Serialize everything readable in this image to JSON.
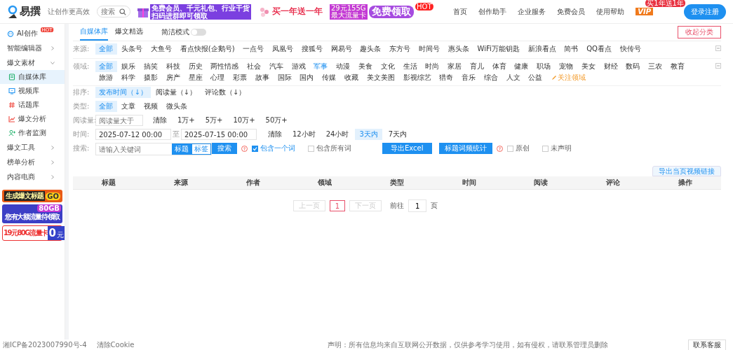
{
  "header": {
    "logo": "易撰",
    "slogan": "让创作更高效",
    "search": {
      "placeholder": "搜索"
    },
    "banners": [
      {
        "kind": "gift",
        "lines": [
          "免费会员、千元礼包、行业干货",
          "扫码进群即可领取"
        ]
      },
      {
        "kind": "flower",
        "lines": [
          "买一年送一年"
        ]
      },
      {
        "kind": "card",
        "lines": [
          "29元155G",
          "最大流量卡",
          "免费领取",
          "HOT"
        ]
      }
    ],
    "nav": [
      "首页",
      "创作助手",
      "企业服务",
      "免费会员",
      "使用帮助"
    ],
    "vip": {
      "label": "VIP",
      "tag": "买1年送1年"
    },
    "login": "登录注册"
  },
  "sidebar": {
    "items": [
      {
        "kind": "link",
        "label": "AI创作",
        "badge": "HOT",
        "selected": false
      },
      {
        "kind": "group",
        "label": "智能编辑器",
        "expanded": false
      },
      {
        "kind": "group",
        "label": "爆文素材",
        "expanded": true,
        "children": [
          {
            "label": "自媒体库",
            "selected": true
          },
          {
            "label": "视频库",
            "selected": false
          },
          {
            "label": "话题库",
            "selected": false
          },
          {
            "label": "爆文分析",
            "selected": false
          },
          {
            "label": "作者监测",
            "selected": false
          }
        ]
      },
      {
        "kind": "group",
        "label": "爆文工具",
        "expanded": false
      },
      {
        "kind": "group",
        "label": "榜单分析",
        "expanded": false
      },
      {
        "kind": "group",
        "label": "内容电商",
        "expanded": false
      }
    ],
    "ads": [
      {
        "kind": "title",
        "lines": [
          "生成爆文标题",
          "GO"
        ]
      },
      {
        "kind": "traffic",
        "lines": [
          "80GB",
          "您有大额流量待领取"
        ]
      },
      {
        "kind": "simcard",
        "lines": [
          "19元80G流量卡",
          "0",
          "元"
        ]
      }
    ]
  },
  "tabs": [
    {
      "label": "自媒体库",
      "selected": true
    },
    {
      "label": "爆文精选",
      "selected": false
    }
  ],
  "simple_mode": {
    "label": "简洁模式",
    "on": false
  },
  "collapse_button": "收起分类",
  "filters": [
    {
      "kind": "options",
      "label": "来源:",
      "expanded": true,
      "options": [
        {
          "label": "全部",
          "selected": true,
          "highlighted": false
        },
        {
          "label": "头条号",
          "selected": false,
          "highlighted": false
        },
        {
          "label": "大鱼号",
          "selected": false,
          "highlighted": false
        },
        {
          "label": "看点快报(企鹅号)",
          "selected": false,
          "highlighted": false
        },
        {
          "label": "一点号",
          "selected": false,
          "highlighted": false
        },
        {
          "label": "凤凰号",
          "selected": false,
          "highlighted": false
        },
        {
          "label": "搜狐号",
          "selected": false,
          "highlighted": false
        },
        {
          "label": "网易号",
          "selected": false,
          "highlighted": false
        },
        {
          "label": "趣头条",
          "selected": false,
          "highlighted": false
        },
        {
          "label": "东方号",
          "selected": false,
          "highlighted": false
        },
        {
          "label": "时间号",
          "selected": false,
          "highlighted": false
        },
        {
          "label": "惠头条",
          "selected": false,
          "highlighted": false
        },
        {
          "label": "WiFi万能钥匙",
          "selected": false,
          "highlighted": false
        },
        {
          "label": "新浪看点",
          "selected": false,
          "highlighted": false
        },
        {
          "label": "简书",
          "selected": false,
          "highlighted": false
        },
        {
          "label": "QQ看点",
          "selected": false,
          "highlighted": false
        },
        {
          "label": "快传号",
          "selected": false,
          "highlighted": false
        }
      ]
    },
    {
      "kind": "options",
      "label": "领域:",
      "expanded": true,
      "extra": "关注领域",
      "options": [
        {
          "label": "全部",
          "selected": true,
          "highlighted": false
        },
        {
          "label": "娱乐",
          "selected": false,
          "highlighted": false
        },
        {
          "label": "搞笑",
          "selected": false,
          "highlighted": false
        },
        {
          "label": "科技",
          "selected": false,
          "highlighted": false
        },
        {
          "label": "历史",
          "selected": false,
          "highlighted": false
        },
        {
          "label": "两性情感",
          "selected": false,
          "highlighted": false
        },
        {
          "label": "社会",
          "selected": false,
          "highlighted": false
        },
        {
          "label": "汽车",
          "selected": false,
          "highlighted": false
        },
        {
          "label": "游戏",
          "selected": false,
          "highlighted": false
        },
        {
          "label": "军事",
          "selected": false,
          "highlighted": true
        },
        {
          "label": "动漫",
          "selected": false,
          "highlighted": false
        },
        {
          "label": "美食",
          "selected": false,
          "highlighted": false
        },
        {
          "label": "文化",
          "selected": false,
          "highlighted": false
        },
        {
          "label": "生活",
          "selected": false,
          "highlighted": false
        },
        {
          "label": "时尚",
          "selected": false,
          "highlighted": false
        },
        {
          "label": "家居",
          "selected": false,
          "highlighted": false
        },
        {
          "label": "育儿",
          "selected": false,
          "highlighted": false
        },
        {
          "label": "体育",
          "selected": false,
          "highlighted": false
        },
        {
          "label": "健康",
          "selected": false,
          "highlighted": false
        },
        {
          "label": "职场",
          "selected": false,
          "highlighted": false
        },
        {
          "label": "宠物",
          "selected": false,
          "highlighted": false
        },
        {
          "label": "美女",
          "selected": false,
          "highlighted": false
        },
        {
          "label": "财经",
          "selected": false,
          "highlighted": false
        },
        {
          "label": "数码",
          "selected": false,
          "highlighted": false
        },
        {
          "label": "三农",
          "selected": false,
          "highlighted": false
        },
        {
          "label": "教育",
          "selected": false,
          "highlighted": false
        },
        {
          "label": "旅游",
          "selected": false,
          "highlighted": false
        },
        {
          "label": "科学",
          "selected": false,
          "highlighted": false
        },
        {
          "label": "摄影",
          "selected": false,
          "highlighted": false
        },
        {
          "label": "房产",
          "selected": false,
          "highlighted": false
        },
        {
          "label": "星座",
          "selected": false,
          "highlighted": false
        },
        {
          "label": "心理",
          "selected": false,
          "highlighted": false
        },
        {
          "label": "彩票",
          "selected": false,
          "highlighted": false
        },
        {
          "label": "故事",
          "selected": false,
          "highlighted": false
        },
        {
          "label": "国际",
          "selected": false,
          "highlighted": false
        },
        {
          "label": "国内",
          "selected": false,
          "highlighted": false
        },
        {
          "label": "传媒",
          "selected": false,
          "highlighted": false
        },
        {
          "label": "收藏",
          "selected": false,
          "highlighted": false
        },
        {
          "label": "美文美图",
          "selected": false,
          "highlighted": false
        },
        {
          "label": "影视综艺",
          "selected": false,
          "highlighted": false
        },
        {
          "label": "猎奇",
          "selected": false,
          "highlighted": false
        },
        {
          "label": "音乐",
          "selected": false,
          "highlighted": false
        },
        {
          "label": "综合",
          "selected": false,
          "highlighted": false
        },
        {
          "label": "人文",
          "selected": false,
          "highlighted": false
        },
        {
          "label": "公益",
          "selected": false,
          "highlighted": false
        }
      ]
    },
    {
      "kind": "options",
      "label": "排序:",
      "options": [
        {
          "label": "发布时间（↓）",
          "selected": true
        },
        {
          "label": "阅读量（↓）",
          "selected": false
        },
        {
          "label": "评论数（↓）",
          "selected": false
        }
      ]
    },
    {
      "kind": "options",
      "label": "类型:",
      "options": [
        {
          "label": "全部",
          "selected": true
        },
        {
          "label": "文章",
          "selected": false
        },
        {
          "label": "视频",
          "selected": false
        },
        {
          "label": "微头条",
          "selected": false
        }
      ]
    },
    {
      "kind": "reads",
      "label": "阅读量:",
      "placeholder": "阅读量大于",
      "options": [
        {
          "label": "清除",
          "selected": false
        },
        {
          "label": "1万+",
          "selected": false
        },
        {
          "label": "5万+",
          "selected": false
        },
        {
          "label": "10万+",
          "selected": false
        },
        {
          "label": "50万+",
          "selected": false
        }
      ]
    },
    {
      "kind": "time",
      "label": "时间:",
      "from": "2025-07-12 00:00",
      "separator": "至",
      "to": "2025-07-15 00:00",
      "options": [
        {
          "label": "清除",
          "selected": false
        },
        {
          "label": "12小时",
          "selected": false
        },
        {
          "label": "24小时",
          "selected": false
        },
        {
          "label": "3天内",
          "selected": true
        },
        {
          "label": "7天内",
          "selected": false
        }
      ]
    },
    {
      "kind": "search",
      "label": "搜索:",
      "placeholder": "请输入关键词",
      "scopes": [
        {
          "label": "标题",
          "selected": true
        },
        {
          "label": "标签",
          "selected": false
        }
      ],
      "button": "搜索",
      "checks": [
        {
          "label": "包含一个词",
          "checked": true
        },
        {
          "label": "包含所有词",
          "checked": false
        }
      ],
      "export": "导出Excel",
      "stats": "标题词频统计",
      "checks2": [
        {
          "label": "原创",
          "checked": false
        },
        {
          "label": "未声明",
          "checked": false
        }
      ]
    }
  ],
  "export_link": "导出当页视频链接",
  "table": {
    "columns": [
      "标题",
      "来源",
      "作者",
      "领域",
      "类型",
      "时间",
      "阅读",
      "评论",
      "操作"
    ]
  },
  "pagination": {
    "prev": "上一页",
    "pages": [
      {
        "label": "1",
        "selected": true
      }
    ],
    "next": "下一页",
    "goto": "前往",
    "page": "1",
    "suffix": "页"
  },
  "footer": {
    "icp": "湘ICP备2023007990号-4",
    "clear": "清除Cookie",
    "notice": "声明：所有信息均来自互联网公开数据，仅供参考学习使用，如有侵权，请联系管理员删除",
    "contact": "联系客服"
  }
}
